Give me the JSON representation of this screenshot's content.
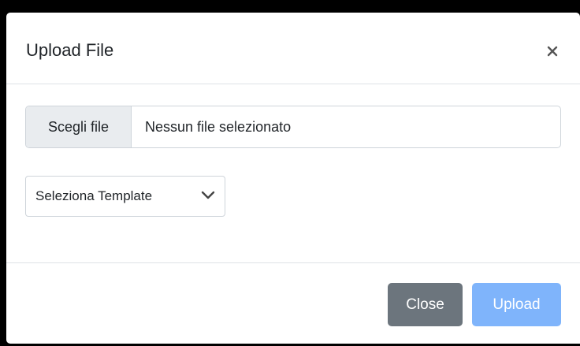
{
  "modal": {
    "title": "Upload File",
    "close_icon": "close-icon"
  },
  "file_input": {
    "button_label": "Scegli file",
    "status_text": "Nessun file selezionato"
  },
  "template_select": {
    "selected": "Seleziona Template",
    "icon": "chevron-down-icon"
  },
  "footer": {
    "close_label": "Close",
    "upload_label": "Upload"
  },
  "colors": {
    "close_button": "#6c757d",
    "upload_button": "#7fb4fb",
    "divider": "#dee2e6"
  }
}
